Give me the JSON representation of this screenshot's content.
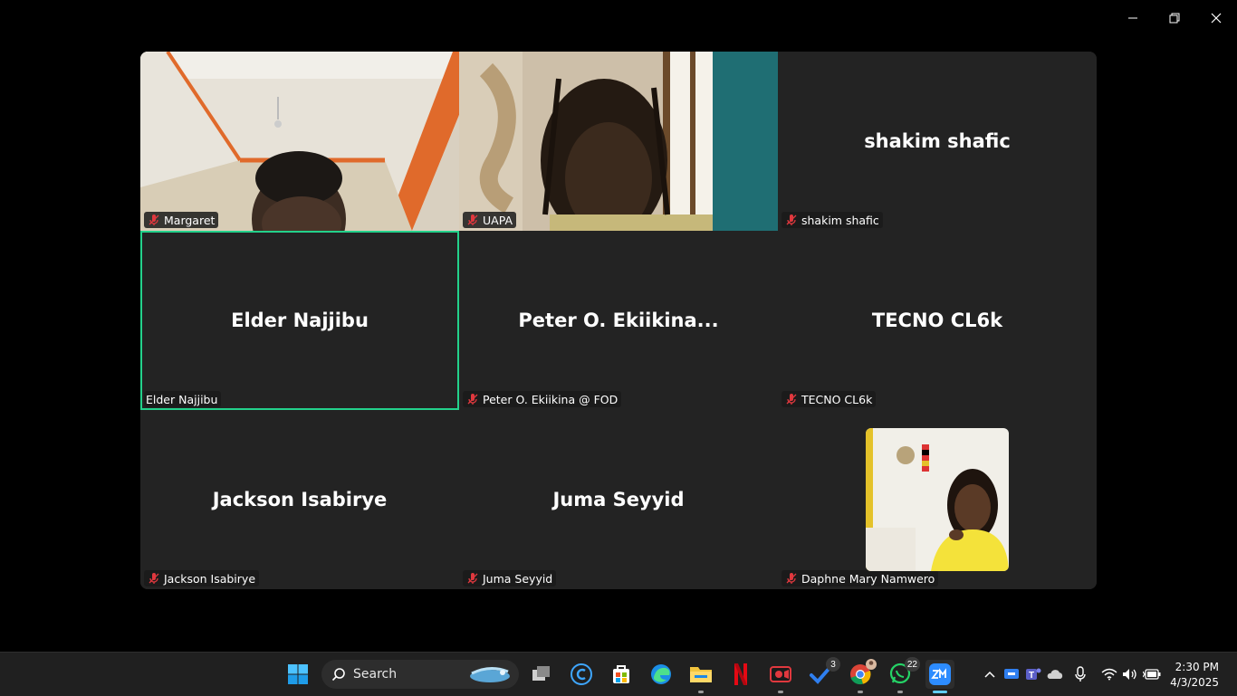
{
  "window_controls": {
    "minimize": "minimize",
    "restore": "restore",
    "close": "close"
  },
  "participants": [
    {
      "display": "Margaret",
      "label": "Margaret",
      "muted": true,
      "video": true
    },
    {
      "display": "UAPA",
      "label": "UAPA",
      "muted": true,
      "video": true
    },
    {
      "display": "shakim shafic",
      "label": "shakim shafic",
      "muted": true,
      "video": false
    },
    {
      "display": "Elder Najjibu",
      "label": "Elder Najjibu",
      "muted": false,
      "video": false,
      "active_speaker": true
    },
    {
      "display": "Peter O. Ekiikina...",
      "label": "Peter O. Ekiikina @ FOD",
      "muted": true,
      "video": false
    },
    {
      "display": "TECNO CL6k",
      "label": "TECNO CL6k",
      "muted": true,
      "video": false
    },
    {
      "display": "Jackson Isabirye",
      "label": "Jackson Isabirye",
      "muted": true,
      "video": false
    },
    {
      "display": "Juma Seyyid",
      "label": "Juma Seyyid",
      "muted": true,
      "video": false
    },
    {
      "display": "Daphne Mary Namwero",
      "label": "Daphne Mary Namwero",
      "muted": true,
      "video": true
    }
  ],
  "taskbar": {
    "search_placeholder": "Search",
    "badges": {
      "todo": "3",
      "whatsapp": "22"
    },
    "clock_time": "2:30 PM",
    "clock_date": "4/3/2025"
  },
  "colors": {
    "active_speaker_border": "#23d18b",
    "tile_bg": "#232323",
    "mute_red": "#e0383e"
  }
}
